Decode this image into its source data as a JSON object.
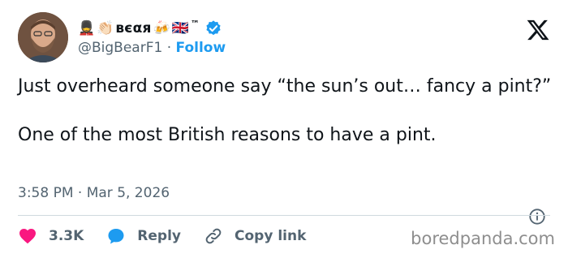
{
  "author": {
    "display_name": "ʙєαя",
    "emoji_prefix": [
      "💂",
      "👏🏻"
    ],
    "emoji_suffix": [
      "🍻",
      "🇬🇧",
      "™"
    ],
    "handle": "@BigBearF1",
    "follow_label": "Follow",
    "verified": true
  },
  "tweet": {
    "text": "Just overheard someone say “the sun’s out… fancy a pint?”\n\nOne of the most British reasons to have a pint.",
    "timestamp": "3:58 PM · Mar 5, 2026"
  },
  "actions": {
    "like_count": "3.3K",
    "reply_label": "Reply",
    "copy_link_label": "Copy link"
  },
  "watermark": "boredpanda.com",
  "colors": {
    "accent": "#1d9bf0",
    "like": "#f91880",
    "muted": "#536471",
    "text": "#0f1419"
  },
  "icons": [
    "x-logo-icon",
    "verified-badge-icon",
    "info-icon",
    "heart-icon",
    "reply-bubble-icon",
    "link-icon"
  ]
}
